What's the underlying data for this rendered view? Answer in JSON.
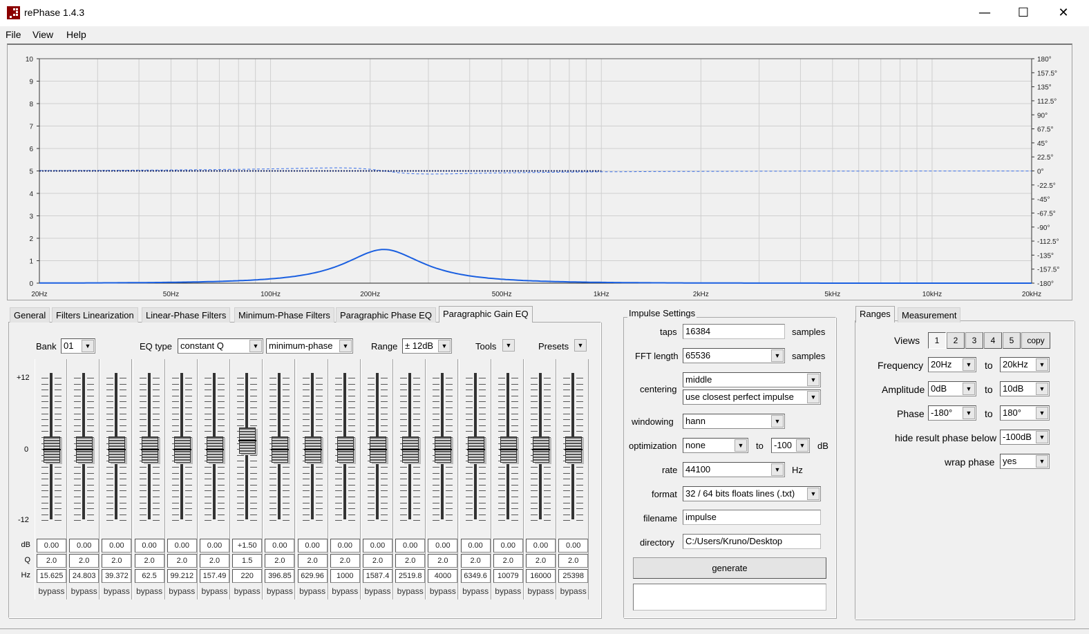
{
  "window": {
    "title": "rePhase 1.4.3",
    "minimize": "—",
    "maximize": "☐",
    "close": "✕"
  },
  "menu": [
    "File",
    "View",
    "Help"
  ],
  "chart_data": {
    "type": "line",
    "x_scale": "log",
    "xlim": [
      20,
      20000
    ],
    "x_ticks": [
      "20Hz",
      "50Hz",
      "100Hz",
      "200Hz",
      "500Hz",
      "1kHz",
      "2kHz",
      "5kHz",
      "10kHz",
      "20kHz"
    ],
    "x_tick_values": [
      20,
      50,
      100,
      200,
      500,
      1000,
      2000,
      5000,
      10000,
      20000
    ],
    "ylim": [
      0,
      10
    ],
    "y_ticks": [
      "0",
      "1",
      "2",
      "3",
      "4",
      "5",
      "6",
      "7",
      "8",
      "9",
      "10"
    ],
    "y2lim": [
      -180,
      180
    ],
    "y2_ticks": [
      "-180°",
      "-157.5°",
      "-135°",
      "-112.5°",
      "-90°",
      "-67.5°",
      "-45°",
      "-22.5°",
      "0°",
      "22.5°",
      "45°",
      "67.5°",
      "90°",
      "112.5°",
      "135°",
      "157.5°",
      "180°"
    ],
    "grid": true,
    "series": [
      {
        "kind": "amplitude",
        "color": "#1a5fe0",
        "peak_freq": 220,
        "peak_gain_db": 1.5,
        "q": 1.5
      },
      {
        "kind": "phase",
        "color": "#3a6fe8",
        "style": "dashed"
      },
      {
        "kind": "result-phase",
        "color": "#1a2a6a",
        "style": "dotted",
        "x_range": [
          20,
          1000
        ],
        "value_deg": 0
      }
    ]
  },
  "eq_tabs": [
    "General",
    "Filters Linearization",
    "Linear-Phase Filters",
    "Minimum-Phase Filters",
    "Paragraphic Phase EQ",
    "Paragraphic Gain EQ"
  ],
  "eq_active_tab": "Paragraphic Gain EQ",
  "eq": {
    "bank_label": "Bank",
    "bank": "01",
    "eq_type_label": "EQ type",
    "eq_type": "constant Q",
    "phase_type": "minimum-phase",
    "range_label": "Range",
    "range": "± 12dB",
    "tools": "Tools",
    "presets": "Presets",
    "scale_top": "+12",
    "scale_mid": "0",
    "scale_bottom": "-12",
    "row_db": "dB",
    "row_q": "Q",
    "row_hz": "Hz",
    "bands": [
      {
        "db": "0.00",
        "q": "2.0",
        "hz": "15.625",
        "bypass": "bypass",
        "value": 0
      },
      {
        "db": "0.00",
        "q": "2.0",
        "hz": "24.803",
        "bypass": "bypass",
        "value": 0
      },
      {
        "db": "0.00",
        "q": "2.0",
        "hz": "39.372",
        "bypass": "bypass",
        "value": 0
      },
      {
        "db": "0.00",
        "q": "2.0",
        "hz": "62.5",
        "bypass": "bypass",
        "value": 0
      },
      {
        "db": "0.00",
        "q": "2.0",
        "hz": "99.212",
        "bypass": "bypass",
        "value": 0
      },
      {
        "db": "0.00",
        "q": "2.0",
        "hz": "157.49",
        "bypass": "bypass",
        "value": 0
      },
      {
        "db": "+1.50",
        "q": "1.5",
        "hz": "220",
        "bypass": "bypass",
        "value": 1.5
      },
      {
        "db": "0.00",
        "q": "2.0",
        "hz": "396.85",
        "bypass": "bypass",
        "value": 0
      },
      {
        "db": "0.00",
        "q": "2.0",
        "hz": "629.96",
        "bypass": "bypass",
        "value": 0
      },
      {
        "db": "0.00",
        "q": "2.0",
        "hz": "1000",
        "bypass": "bypass",
        "value": 0
      },
      {
        "db": "0.00",
        "q": "2.0",
        "hz": "1587.4",
        "bypass": "bypass",
        "value": 0
      },
      {
        "db": "0.00",
        "q": "2.0",
        "hz": "2519.8",
        "bypass": "bypass",
        "value": 0
      },
      {
        "db": "0.00",
        "q": "2.0",
        "hz": "4000",
        "bypass": "bypass",
        "value": 0
      },
      {
        "db": "0.00",
        "q": "2.0",
        "hz": "6349.6",
        "bypass": "bypass",
        "value": 0
      },
      {
        "db": "0.00",
        "q": "2.0",
        "hz": "10079",
        "bypass": "bypass",
        "value": 0
      },
      {
        "db": "0.00",
        "q": "2.0",
        "hz": "16000",
        "bypass": "bypass",
        "value": 0
      },
      {
        "db": "0.00",
        "q": "2.0",
        "hz": "25398",
        "bypass": "bypass",
        "value": 0
      }
    ]
  },
  "impulse": {
    "title": "Impulse Settings",
    "taps_label": "taps",
    "taps": "16384",
    "samples1": "samples",
    "fft_label": "FFT length",
    "fft": "65536",
    "samples2": "samples",
    "centering_label": "centering",
    "centering": "middle",
    "centering2": "use closest perfect impulse",
    "windowing_label": "windowing",
    "windowing": "hann",
    "optimization_label": "optimization",
    "optimization": "none",
    "to": "to",
    "opt_db": "-100",
    "db": "dB",
    "rate_label": "rate",
    "rate": "44100",
    "hz": "Hz",
    "format_label": "format",
    "format": "32 / 64 bits floats lines (.txt)",
    "filename_label": "filename",
    "filename": "impulse",
    "directory_label": "directory",
    "directory": "C:/Users/Kruno/Desktop",
    "generate": "generate",
    "output": ""
  },
  "ranges": {
    "tabs": [
      "Ranges",
      "Measurement"
    ],
    "views_label": "Views",
    "views": [
      "1",
      "2",
      "3",
      "4",
      "5",
      "copy"
    ],
    "freq_label": "Frequency",
    "freq_from": "20Hz",
    "freq_to": "20kHz",
    "amp_label": "Amplitude",
    "amp_from": "0dB",
    "amp_to": "10dB",
    "phase_label": "Phase",
    "phase_from": "-180°",
    "phase_to": "180°",
    "to": "to",
    "hide_label": "hide result phase below",
    "hide": "-100dB",
    "wrap_label": "wrap phase",
    "wrap": "yes"
  }
}
